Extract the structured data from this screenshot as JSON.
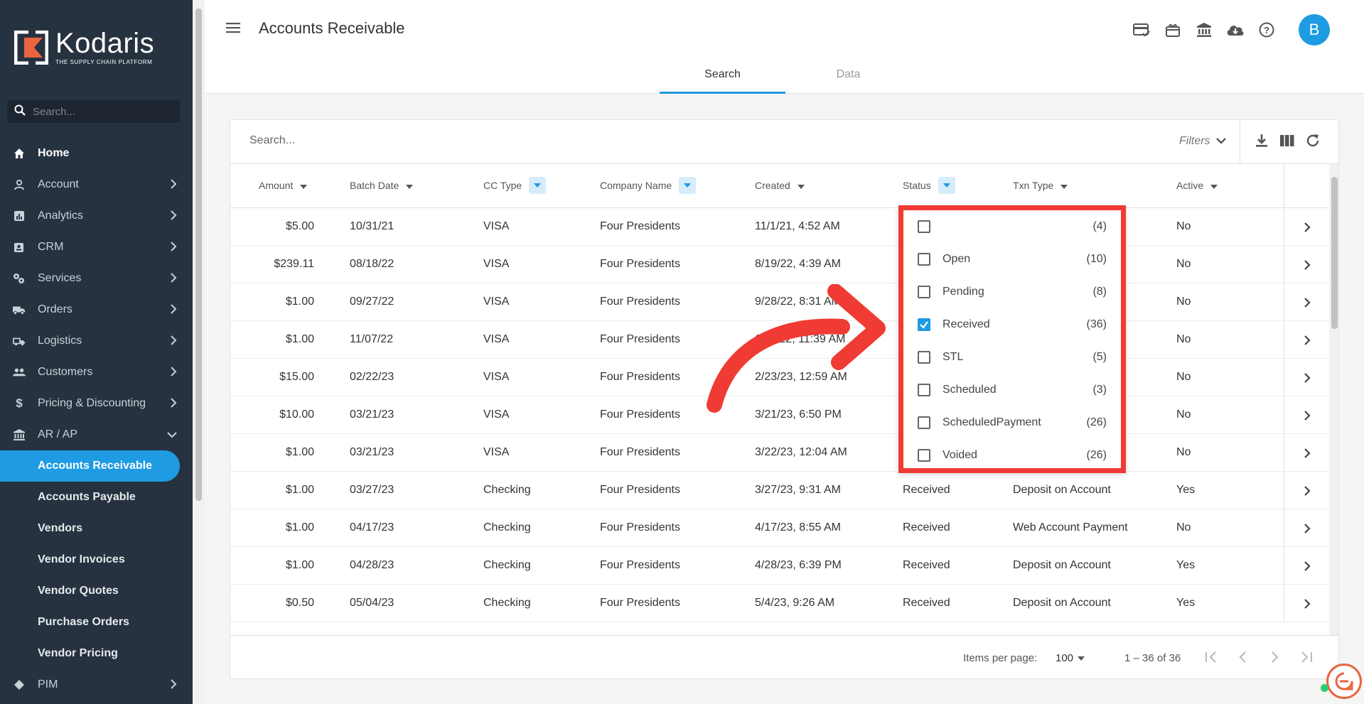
{
  "brand": {
    "name": "Kodaris",
    "tagline": "THE SUPPLY CHAIN PLATFORM"
  },
  "sidebar": {
    "search_placeholder": "Search...",
    "items": [
      {
        "label": "Home",
        "icon": "home-icon",
        "chevron": false,
        "top": true
      },
      {
        "label": "Account",
        "icon": "person-icon",
        "chevron": true
      },
      {
        "label": "Analytics",
        "icon": "analytics-icon",
        "chevron": true
      },
      {
        "label": "CRM",
        "icon": "crm-icon",
        "chevron": true
      },
      {
        "label": "Services",
        "icon": "services-icon",
        "chevron": true
      },
      {
        "label": "Orders",
        "icon": "truck-icon",
        "chevron": true
      },
      {
        "label": "Logistics",
        "icon": "logistics-icon",
        "chevron": true
      },
      {
        "label": "Customers",
        "icon": "people-icon",
        "chevron": true
      },
      {
        "label": "Pricing & Discounting",
        "icon": "dollar-icon",
        "chevron": true
      },
      {
        "label": "AR / AP",
        "icon": "bank-icon",
        "chevron": "down"
      }
    ],
    "sub_items": [
      {
        "label": "Accounts Receivable",
        "active": true
      },
      {
        "label": "Accounts Payable"
      },
      {
        "label": "Vendors"
      },
      {
        "label": "Vendor Invoices"
      },
      {
        "label": "Vendor Quotes"
      },
      {
        "label": "Purchase Orders"
      },
      {
        "label": "Vendor Pricing"
      }
    ],
    "bottom_item": {
      "label": "PIM",
      "icon": "tag-icon"
    }
  },
  "header": {
    "title": "Accounts Receivable",
    "avatar_letter": "B",
    "icons": [
      "card-check-icon",
      "gift-card-icon",
      "bank-icon",
      "cloud-download-icon",
      "help-icon"
    ],
    "tabs": [
      {
        "label": "Search",
        "active": true
      },
      {
        "label": "Data"
      }
    ]
  },
  "toolbar": {
    "search_placeholder": "Search...",
    "filters_label": "Filters",
    "tools": [
      "download-icon",
      "columns-icon",
      "refresh-icon"
    ]
  },
  "table": {
    "columns": [
      {
        "label": "Amount",
        "kind": "sort"
      },
      {
        "label": "Batch Date",
        "kind": "sort"
      },
      {
        "label": "CC Type",
        "kind": "filter"
      },
      {
        "label": "Company Name",
        "kind": "filter"
      },
      {
        "label": "Created",
        "kind": "sort"
      },
      {
        "label": "Status",
        "kind": "filter"
      },
      {
        "label": "Txn Type",
        "kind": "sort"
      },
      {
        "label": "Active",
        "kind": "sort"
      }
    ],
    "rows": [
      {
        "amount": "$5.00",
        "batch_date": "10/31/21",
        "cc_type": "VISA",
        "company": "Four Presidents",
        "created": "11/1/21, 4:52 AM",
        "status": "",
        "txn_type": "",
        "active": "No"
      },
      {
        "amount": "$239.11",
        "batch_date": "08/18/22",
        "cc_type": "VISA",
        "company": "Four Presidents",
        "created": "8/19/22, 4:39 AM",
        "status": "",
        "txn_type": "",
        "active": "No"
      },
      {
        "amount": "$1.00",
        "batch_date": "09/27/22",
        "cc_type": "VISA",
        "company": "Four Presidents",
        "created": "9/28/22, 8:31 AM",
        "status": "",
        "txn_type": "",
        "active": "No"
      },
      {
        "amount": "$1.00",
        "batch_date": "11/07/22",
        "cc_type": "VISA",
        "company": "Four Presidents",
        "created": "11/8/22, 11:39 AM",
        "status": "",
        "txn_type": "",
        "active": "No"
      },
      {
        "amount": "$15.00",
        "batch_date": "02/22/23",
        "cc_type": "VISA",
        "company": "Four Presidents",
        "created": "2/23/23, 12:59 AM",
        "status": "",
        "txn_type": "",
        "active": "No"
      },
      {
        "amount": "$10.00",
        "batch_date": "03/21/23",
        "cc_type": "VISA",
        "company": "Four Presidents",
        "created": "3/21/23, 6:50 PM",
        "status": "",
        "txn_type": "",
        "active": "No"
      },
      {
        "amount": "$1.00",
        "batch_date": "03/21/23",
        "cc_type": "VISA",
        "company": "Four Presidents",
        "created": "3/22/23, 12:04 AM",
        "status": "",
        "txn_type": "",
        "active": "No"
      },
      {
        "amount": "$1.00",
        "batch_date": "03/27/23",
        "cc_type": "Checking",
        "company": "Four Presidents",
        "created": "3/27/23, 9:31 AM",
        "status": "Received",
        "txn_type": "Deposit on Account",
        "active": "Yes"
      },
      {
        "amount": "$1.00",
        "batch_date": "04/17/23",
        "cc_type": "Checking",
        "company": "Four Presidents",
        "created": "4/17/23, 8:55 AM",
        "status": "Received",
        "txn_type": "Web Account Payment",
        "active": "No"
      },
      {
        "amount": "$1.00",
        "batch_date": "04/28/23",
        "cc_type": "Checking",
        "company": "Four Presidents",
        "created": "4/28/23, 6:39 PM",
        "status": "Received",
        "txn_type": "Deposit on Account",
        "active": "Yes"
      },
      {
        "amount": "$0.50",
        "batch_date": "05/04/23",
        "cc_type": "Checking",
        "company": "Four Presidents",
        "created": "5/4/23, 9:26 AM",
        "status": "Received",
        "txn_type": "Deposit on Account",
        "active": "Yes"
      }
    ]
  },
  "status_filter": {
    "options": [
      {
        "label": "",
        "count": "(4)",
        "checked": false
      },
      {
        "label": "Open",
        "count": "(10)",
        "checked": false
      },
      {
        "label": "Pending",
        "count": "(8)",
        "checked": false
      },
      {
        "label": "Received",
        "count": "(36)",
        "checked": true
      },
      {
        "label": "STL",
        "count": "(5)",
        "checked": false
      },
      {
        "label": "Scheduled",
        "count": "(3)",
        "checked": false
      },
      {
        "label": "ScheduledPayment",
        "count": "(26)",
        "checked": false
      },
      {
        "label": "Voided",
        "count": "(26)",
        "checked": false
      }
    ]
  },
  "paginator": {
    "items_per_page_label": "Items per page:",
    "page_size": "100",
    "range": "1 – 36 of 36"
  },
  "colors": {
    "sidebar": "#273240",
    "accent": "#1e9be3",
    "highlight": "#ef3b33"
  }
}
